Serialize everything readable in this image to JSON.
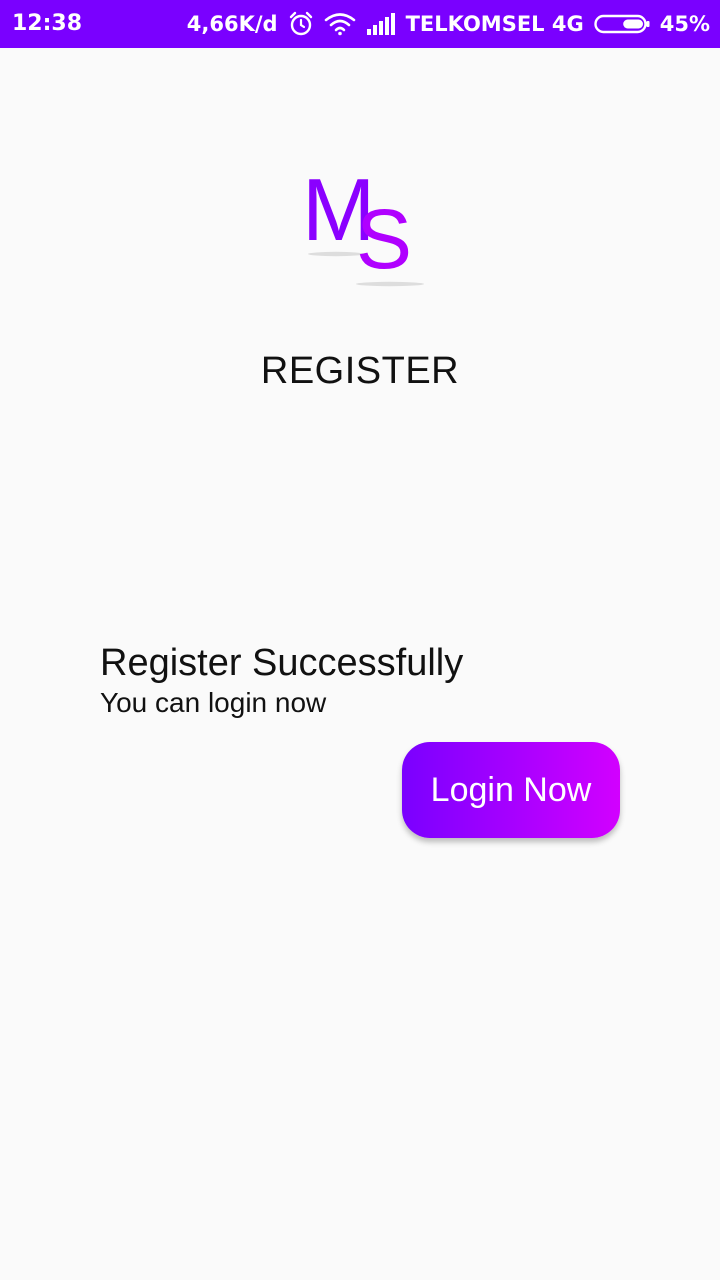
{
  "status_bar": {
    "time": "12:38",
    "network_speed": "4,66K/d",
    "carrier": "TELKOMSEL 4G",
    "battery": "45%",
    "battery_level": 0.45,
    "background_color": "#7a00ff",
    "icons": [
      "alarm-icon",
      "wifi-icon",
      "signal-icon",
      "battery-icon"
    ]
  },
  "logo": {
    "text_m": "M",
    "text_s": "S",
    "colors": [
      "#8a00ff",
      "#b000ff"
    ]
  },
  "page": {
    "title": "REGISTER"
  },
  "message": {
    "title": "Register Successfully",
    "subtitle": "You can login now"
  },
  "actions": {
    "login_label": "Login Now",
    "gradient_start": "#7a00ff",
    "gradient_end": "#d200ff"
  }
}
